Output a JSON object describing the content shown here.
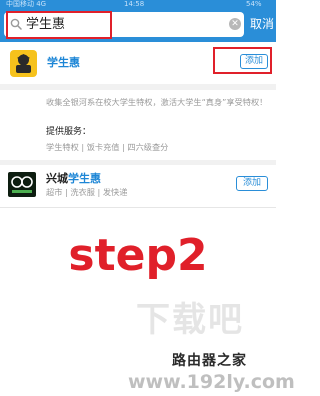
{
  "status": {
    "carrier": "中国移动 4G",
    "time": "14:58",
    "battery": "54%"
  },
  "search": {
    "query": "学生惠",
    "cancel_label": "取消"
  },
  "result1": {
    "name": "学生惠",
    "add_label": "添加",
    "description": "收集全银河系在校大学生特权，激活大学生“真身”享受特权！",
    "services_title": "提供服务：",
    "services": "学生特权 | 饭卡充值 | 四六级查分"
  },
  "result2": {
    "name_prefix": "兴城",
    "name_highlight": "学生惠",
    "add_label": "添加",
    "tags": "超市 | 洗衣服 | 发快递"
  },
  "overlay": {
    "step_text": "step2"
  },
  "watermark": {
    "large": "下载吧",
    "brand": "路由器之家",
    "url": "www.192ly.com"
  },
  "colors": {
    "accent": "#2a8ed8",
    "highlight_box": "#e0202a",
    "logo_yellow": "#f6c21c"
  },
  "icons": [
    "search-icon",
    "clear-icon",
    "graduate-logo-icon",
    "xingcheng-logo-icon"
  ]
}
